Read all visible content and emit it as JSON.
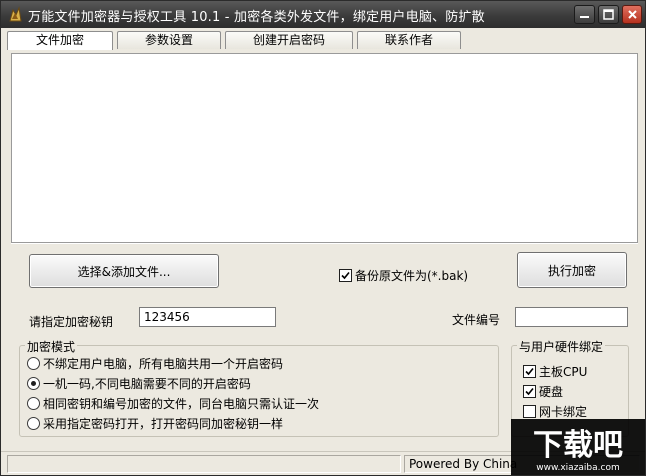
{
  "window": {
    "title": "万能文件加密器与授权工具 10.1 - 加密各类外发文件，绑定用户电脑、防扩散",
    "icon": "app-icon"
  },
  "tabs": [
    {
      "label": "文件加密",
      "active": true
    },
    {
      "label": "参数设置",
      "active": false
    },
    {
      "label": "创建开启密码",
      "active": false
    },
    {
      "label": "联系作者",
      "active": false
    }
  ],
  "actions": {
    "select_files_label": "选择&添加文件...",
    "backup_label": "备份原文件为(*.bak)",
    "backup_checked": true,
    "execute_label": "执行加密"
  },
  "key": {
    "label": "请指定加密秘钥",
    "value": "123456"
  },
  "file_number": {
    "label": "文件编号",
    "value": ""
  },
  "encrypt_mode": {
    "title": "加密模式",
    "options": [
      {
        "label": "不绑定用户电脑，所有电脑共用一个开启密码",
        "selected": false
      },
      {
        "label": "一机一码,不同电脑需要不同的开启密码",
        "selected": true
      },
      {
        "label": "相同密钥和编号加密的文件，同台电脑只需认证一次",
        "selected": false
      },
      {
        "label": "采用指定密码打开，打开密码同加密秘钥一样",
        "selected": false
      }
    ]
  },
  "hardware_binding": {
    "title": "与用户硬件绑定",
    "options": [
      {
        "label": "主板CPU",
        "checked": true
      },
      {
        "label": "硬盘",
        "checked": true
      },
      {
        "label": "网卡绑定",
        "checked": false
      }
    ]
  },
  "status": {
    "text": "Powered By China"
  },
  "watermark": {
    "brand": "下载吧",
    "url": "www.xiazaiba.com"
  },
  "colors": {
    "titlebar": "#3b3b3b",
    "close_button": "#c9432e"
  }
}
